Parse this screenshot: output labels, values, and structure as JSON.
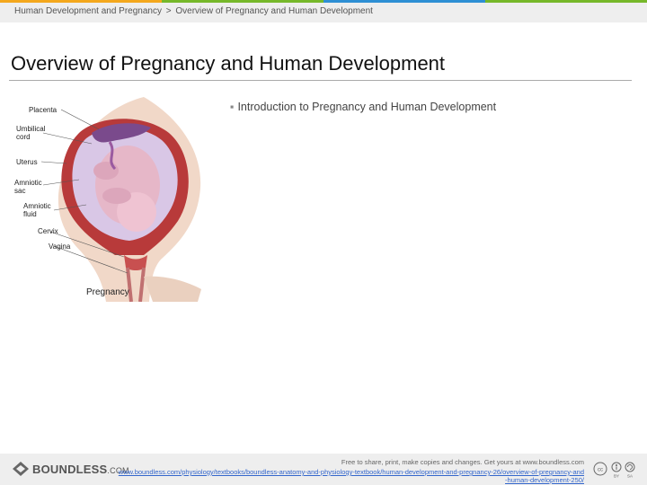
{
  "colors": {
    "stripe": [
      "#f4a81d",
      "#76b82a",
      "#2e8fd4",
      "#76b82a"
    ],
    "header_bg": "#eeeeee",
    "link": "#3366cc"
  },
  "header": {
    "crumb_1": "Human Development and Pregnancy",
    "separator": ">",
    "crumb_2": "Overview of Pregnancy and Human Development"
  },
  "slide": {
    "title": "Overview of Pregnancy and Human Development",
    "bullets": [
      "Introduction to Pregnancy and Human Development"
    ]
  },
  "figure": {
    "labels": {
      "placenta": "Placenta",
      "umbilical_1": "Umbilical",
      "umbilical_2": "cord",
      "uterus": "Uterus",
      "amniotic_sac_1": "Amniotic",
      "amniotic_sac_2": "sac",
      "amniotic_fluid_1": "Amniotic",
      "amniotic_fluid_2": "fluid",
      "cervix": "Cervix",
      "vagina": "Vagina"
    },
    "caption": "Pregnancy"
  },
  "footer": {
    "logo_main": "BOUNDLESS",
    "logo_suffix": ".COM",
    "share_text": "Free to share, print, make copies and changes. Get yours at www.boundless.com",
    "link": "www.boundless.com/physiology/textbooks/boundless-anatomy-and-physiology-textbook/human-development-and-pregnancy-26/overview-of-pregnancy-and-human-development-250/",
    "license": {
      "cc": "cc",
      "by": "BY",
      "sa": "SA"
    }
  }
}
